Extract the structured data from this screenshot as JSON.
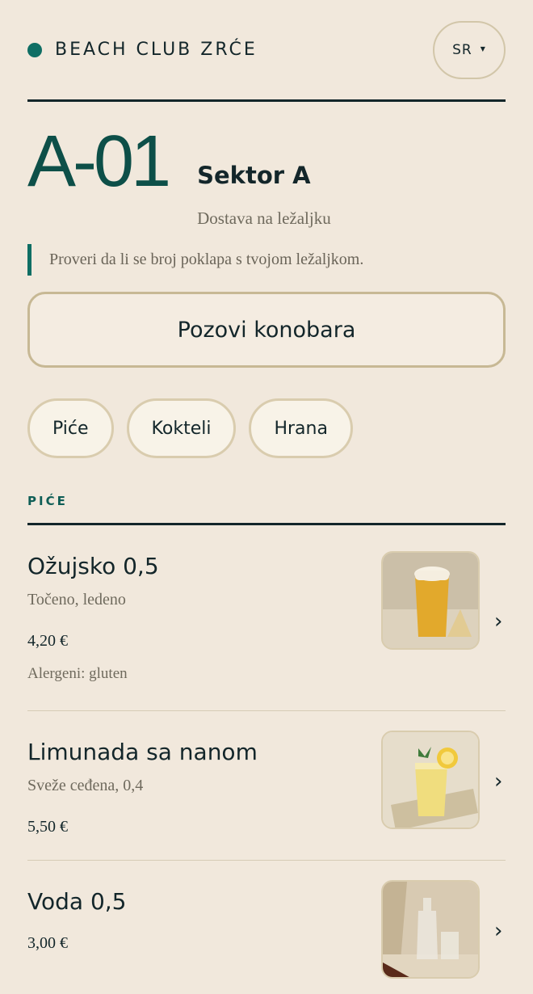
{
  "header": {
    "brand": "BEACH CLUB ZRĆE",
    "lang": "SR"
  },
  "seat": {
    "code": "A-01",
    "sector": "Sektor A",
    "delivery": "Dostava na ležaljku"
  },
  "notice": "Proveri da li se broj poklapa s tvojom ležaljkom.",
  "call_button": "Pozovi konobara",
  "categories": [
    "Piće",
    "Kokteli",
    "Hrana"
  ],
  "section": "PIĆE",
  "items": [
    {
      "name": "Ožujsko 0,5",
      "desc": "Točeno, ledeno",
      "price": "4,20 €",
      "allergens": "Alergeni: gluten"
    },
    {
      "name": "Limunada sa nanom",
      "desc": "Sveže ceđena, 0,4",
      "price": "5,50 €"
    },
    {
      "name": "Voda 0,5",
      "price": "3,00 €"
    }
  ]
}
